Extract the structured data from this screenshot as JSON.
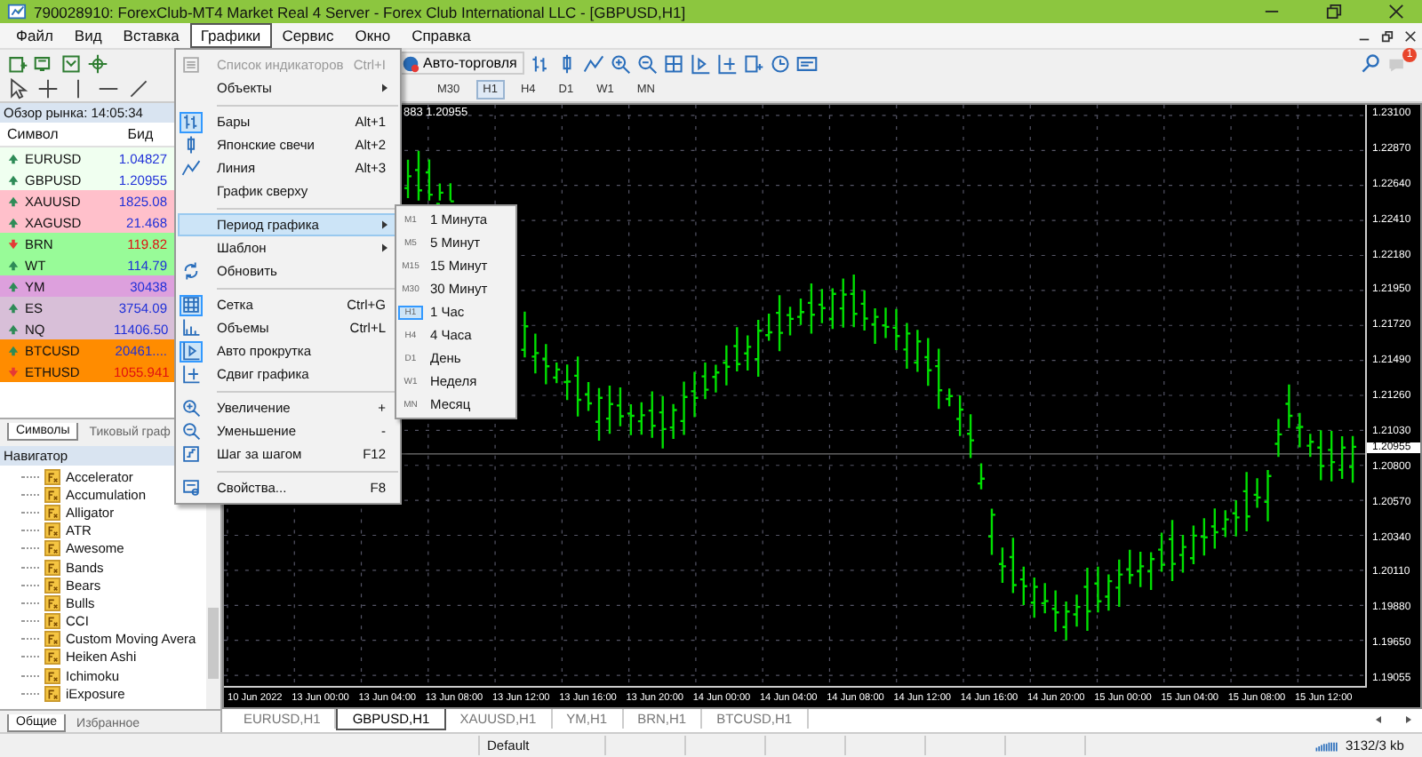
{
  "window": {
    "title": "790028910: ForexClub-MT4 Market Real 4 Server - Forex Club International LLC - [GBPUSD,H1]"
  },
  "menu": [
    {
      "label": "Файл",
      "selected": false
    },
    {
      "label": "Вид",
      "selected": false
    },
    {
      "label": "Вставка",
      "selected": false
    },
    {
      "label": "Графики",
      "selected": true
    },
    {
      "label": "Сервис",
      "selected": false
    },
    {
      "label": "Окно",
      "selected": false
    },
    {
      "label": "Справка",
      "selected": false
    }
  ],
  "toolbar": {
    "autotrading": "Авто-торговля",
    "notification_count": "1"
  },
  "timeframes": [
    {
      "label": "M30",
      "selected": false
    },
    {
      "label": "H1",
      "selected": true
    },
    {
      "label": "H4",
      "selected": false
    },
    {
      "label": "D1",
      "selected": false
    },
    {
      "label": "W1",
      "selected": false
    },
    {
      "label": "MN",
      "selected": false
    }
  ],
  "chart_menu": [
    {
      "kind": "item",
      "label": "Список индикаторов",
      "shortcut": "Ctrl+I",
      "disabled": true,
      "checked": false,
      "selected": false,
      "submenu": false
    },
    {
      "kind": "item",
      "label": "Объекты",
      "disabled": false,
      "checked": false,
      "selected": false,
      "submenu": true
    },
    {
      "kind": "separator"
    },
    {
      "kind": "item",
      "label": "Бары",
      "shortcut": "Alt+1",
      "disabled": false,
      "checked": true,
      "selected": false,
      "submenu": false
    },
    {
      "kind": "item",
      "label": "Японские свечи",
      "shortcut": "Alt+2",
      "disabled": false,
      "checked": false,
      "selected": false,
      "submenu": false
    },
    {
      "kind": "item",
      "label": "Линия",
      "shortcut": "Alt+3",
      "disabled": false,
      "checked": false,
      "selected": false,
      "submenu": false
    },
    {
      "kind": "item",
      "label": "График сверху",
      "disabled": false,
      "checked": false,
      "selected": false,
      "submenu": false
    },
    {
      "kind": "separator"
    },
    {
      "kind": "item",
      "label": "Период графика",
      "disabled": false,
      "checked": false,
      "selected": true,
      "submenu": true
    },
    {
      "kind": "item",
      "label": "Шаблон",
      "disabled": false,
      "checked": false,
      "selected": false,
      "submenu": true
    },
    {
      "kind": "item",
      "label": "Обновить",
      "disabled": false,
      "checked": false,
      "selected": false,
      "submenu": false
    },
    {
      "kind": "separator"
    },
    {
      "kind": "item",
      "label": "Сетка",
      "shortcut": "Ctrl+G",
      "disabled": false,
      "checked": true,
      "selected": false,
      "submenu": false
    },
    {
      "kind": "item",
      "label": "Объемы",
      "shortcut": "Ctrl+L",
      "disabled": false,
      "checked": false,
      "selected": false,
      "submenu": false
    },
    {
      "kind": "item",
      "label": "Авто прокрутка",
      "disabled": false,
      "checked": true,
      "selected": false,
      "submenu": false
    },
    {
      "kind": "item",
      "label": "Сдвиг графика",
      "disabled": false,
      "checked": false,
      "selected": false,
      "submenu": false
    },
    {
      "kind": "separator"
    },
    {
      "kind": "item",
      "label": "Увеличение",
      "shortcut": "+",
      "disabled": false,
      "checked": false,
      "selected": false,
      "submenu": false
    },
    {
      "kind": "item",
      "label": "Уменьшение",
      "shortcut": "-",
      "disabled": false,
      "checked": false,
      "selected": false,
      "submenu": false
    },
    {
      "kind": "item",
      "label": "Шаг за шагом",
      "shortcut": "F12",
      "disabled": false,
      "checked": false,
      "selected": false,
      "submenu": false
    },
    {
      "kind": "separator"
    },
    {
      "kind": "item",
      "label": "Свойства...",
      "shortcut": "F8",
      "disabled": false,
      "checked": false,
      "selected": false,
      "submenu": false
    }
  ],
  "period_menu": [
    {
      "code": "M1",
      "label": "1 Минута",
      "selected": false
    },
    {
      "code": "M5",
      "label": "5 Минут",
      "selected": false
    },
    {
      "code": "M15",
      "label": "15 Минут",
      "selected": false
    },
    {
      "code": "M30",
      "label": "30 Минут",
      "selected": false
    },
    {
      "code": "H1",
      "label": "1 Час",
      "selected": true
    },
    {
      "code": "H4",
      "label": "4 Часа",
      "selected": false
    },
    {
      "code": "D1",
      "label": "День",
      "selected": false
    },
    {
      "code": "W1",
      "label": "Неделя",
      "selected": false
    },
    {
      "code": "MN",
      "label": "Месяц",
      "selected": false
    }
  ],
  "market_watch": {
    "title": "Обзор рынка: 14:05:34",
    "columns": [
      "Символ",
      "Бид"
    ],
    "rows": [
      {
        "symbol": "EURUSD",
        "bid": "1.04827",
        "kind": "up",
        "color": "#f0fff0"
      },
      {
        "symbol": "GBPUSD",
        "bid": "1.20955",
        "kind": "up",
        "color": "#f0fff0"
      },
      {
        "symbol": "XAUUSD",
        "bid": "1825.08",
        "kind": "up",
        "color": "#ffc0cb"
      },
      {
        "symbol": "XAGUSD",
        "bid": "21.468",
        "kind": "up",
        "color": "#ffc0cb"
      },
      {
        "symbol": "BRN",
        "bid": "119.82",
        "kind": "down",
        "color": "#98fb98"
      },
      {
        "symbol": "WT",
        "bid": "114.79",
        "kind": "up",
        "color": "#98fb98"
      },
      {
        "symbol": "YM",
        "bid": "30438",
        "kind": "up",
        "color": "#dda0dd"
      },
      {
        "symbol": "ES",
        "bid": "3754.09",
        "kind": "up",
        "color": "#d8bfd8"
      },
      {
        "symbol": "NQ",
        "bid": "11406.50",
        "kind": "up",
        "color": "#d8bfd8"
      },
      {
        "symbol": "BTCUSD",
        "bid": "20461....",
        "kind": "up",
        "color": "#ff8c00"
      },
      {
        "symbol": "ETHUSD",
        "bid": "1055.941",
        "kind": "down",
        "color": "#ff8c00"
      }
    ],
    "tabs": [
      {
        "label": "Символы",
        "selected": true
      },
      {
        "label": "Тиковый граф",
        "selected": false
      }
    ]
  },
  "navigator": {
    "title": "Навигатор",
    "items": [
      "Accelerator",
      "Accumulation",
      "Alligator",
      "ATR",
      "Awesome",
      "Bands",
      "Bears",
      "Bulls",
      "CCI",
      "Custom Moving Avera",
      "Heiken Ashi",
      "Ichimoku",
      "iExposure"
    ],
    "tabs": [
      {
        "label": "Общие",
        "selected": true
      },
      {
        "label": "Избранное",
        "selected": false
      }
    ]
  },
  "chart": {
    "header": "883 1.20955",
    "current_price": "1.20955",
    "price_labels": [
      "1.23100",
      "1.22870",
      "1.22640",
      "1.22410",
      "1.22180",
      "1.21950",
      "1.21720",
      "1.21490",
      "1.21260",
      "1.21030",
      "1.20800",
      "1.20570",
      "1.20340",
      "1.20110",
      "1.19880",
      "1.19650",
      "1.19055"
    ],
    "time_labels": [
      "10 Jun 2022",
      "13 Jun 00:00",
      "13 Jun 04:00",
      "13 Jun 08:00",
      "13 Jun 12:00",
      "13 Jun 16:00",
      "13 Jun 20:00",
      "14 Jun 00:00",
      "14 Jun 04:00",
      "14 Jun 08:00",
      "14 Jun 12:00",
      "14 Jun 16:00",
      "14 Jun 20:00",
      "15 Jun 00:00",
      "15 Jun 04:00",
      "15 Jun 08:00",
      "15 Jun 12:00"
    ]
  },
  "chart_tabs": [
    {
      "label": "EURUSD,H1",
      "selected": false
    },
    {
      "label": "GBPUSD,H1",
      "selected": true
    },
    {
      "label": "XAUUSD,H1",
      "selected": false
    },
    {
      "label": "YM,H1",
      "selected": false
    },
    {
      "label": "BRN,H1",
      "selected": false
    },
    {
      "label": "BTCUSD,H1",
      "selected": false
    }
  ],
  "status_bar": {
    "profile": "Default",
    "traffic": "3132/3 kb"
  }
}
